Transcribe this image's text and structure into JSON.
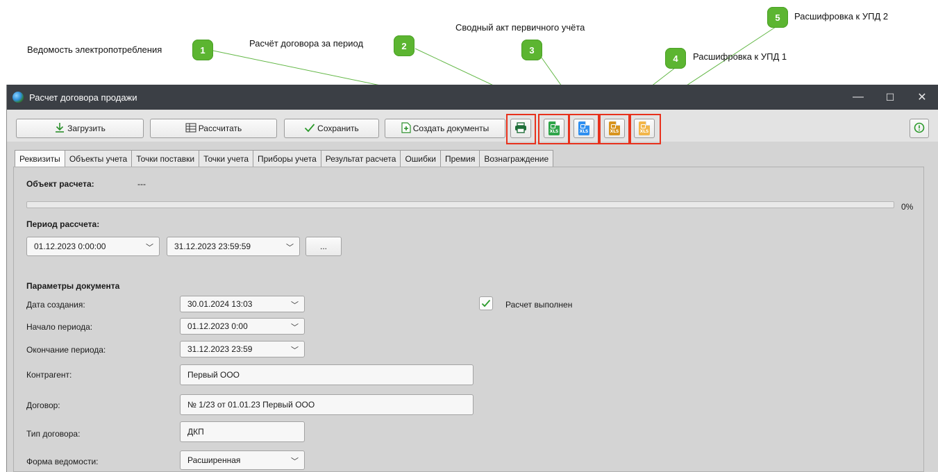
{
  "callouts": [
    {
      "num": "1",
      "label": "Ведомость электропотребления"
    },
    {
      "num": "2",
      "label": "Расчёт договора за период"
    },
    {
      "num": "3",
      "label": "Сводный акт первичного учёта"
    },
    {
      "num": "4",
      "label": "Расшифровка к УПД 1"
    },
    {
      "num": "5",
      "label": "Расшифровка к УПД 2"
    }
  ],
  "window": {
    "title": "Расчет договора продажи",
    "minimize": "—",
    "maximize": "☐",
    "close": "✕"
  },
  "toolbar": {
    "load_label": "Загрузить",
    "calculate_label": "Рассчитать",
    "save_label": "Сохранить",
    "create_docs_label": "Создать документы",
    "xls_text": "XLS",
    "colors": {
      "accent": "#e8311c",
      "badge": "#5cb531",
      "xls1": "#2fa54a",
      "xls2": "#2f8ff0",
      "xls3": "#d8941e",
      "xls4": "#f2b64a"
    }
  },
  "tabs": [
    "Реквизиты",
    "Объекты учета",
    "Точки поставки",
    "Точки учета",
    "Приборы учета",
    "Результат расчета",
    "Ошибки",
    "Премия",
    "Вознаграждение"
  ],
  "main": {
    "object_label": "Объект расчета:",
    "object_value": "---",
    "progress_text": "0%",
    "progress_value": 0,
    "period_label": "Период рассчета:",
    "period_from": "01.12.2023 0:00:00",
    "period_to": "31.12.2023 23:59:59",
    "period_more": "...",
    "params_title": "Параметры документа",
    "rows": {
      "created_label": "Дата создания:",
      "created_value": "30.01.2024 13:03",
      "start_label": "Начало периода:",
      "start_value": "01.12.2023 0:00",
      "end_label": "Окончание периода:",
      "end_value": "31.12.2023 23:59",
      "counterparty_label": "Контрагент:",
      "counterparty_value": "Первый ООО",
      "contract_label": "Договор:",
      "contract_value": "№ 1/23 от 01.01.23 Первый ООО",
      "contract_type_label": "Тип договора:",
      "contract_type_value": "ДКП",
      "form_label": "Форма ведомости:",
      "form_value": "Расширенная"
    },
    "calc_done_label": "Расчет выполнен",
    "calc_done_checked": true
  }
}
